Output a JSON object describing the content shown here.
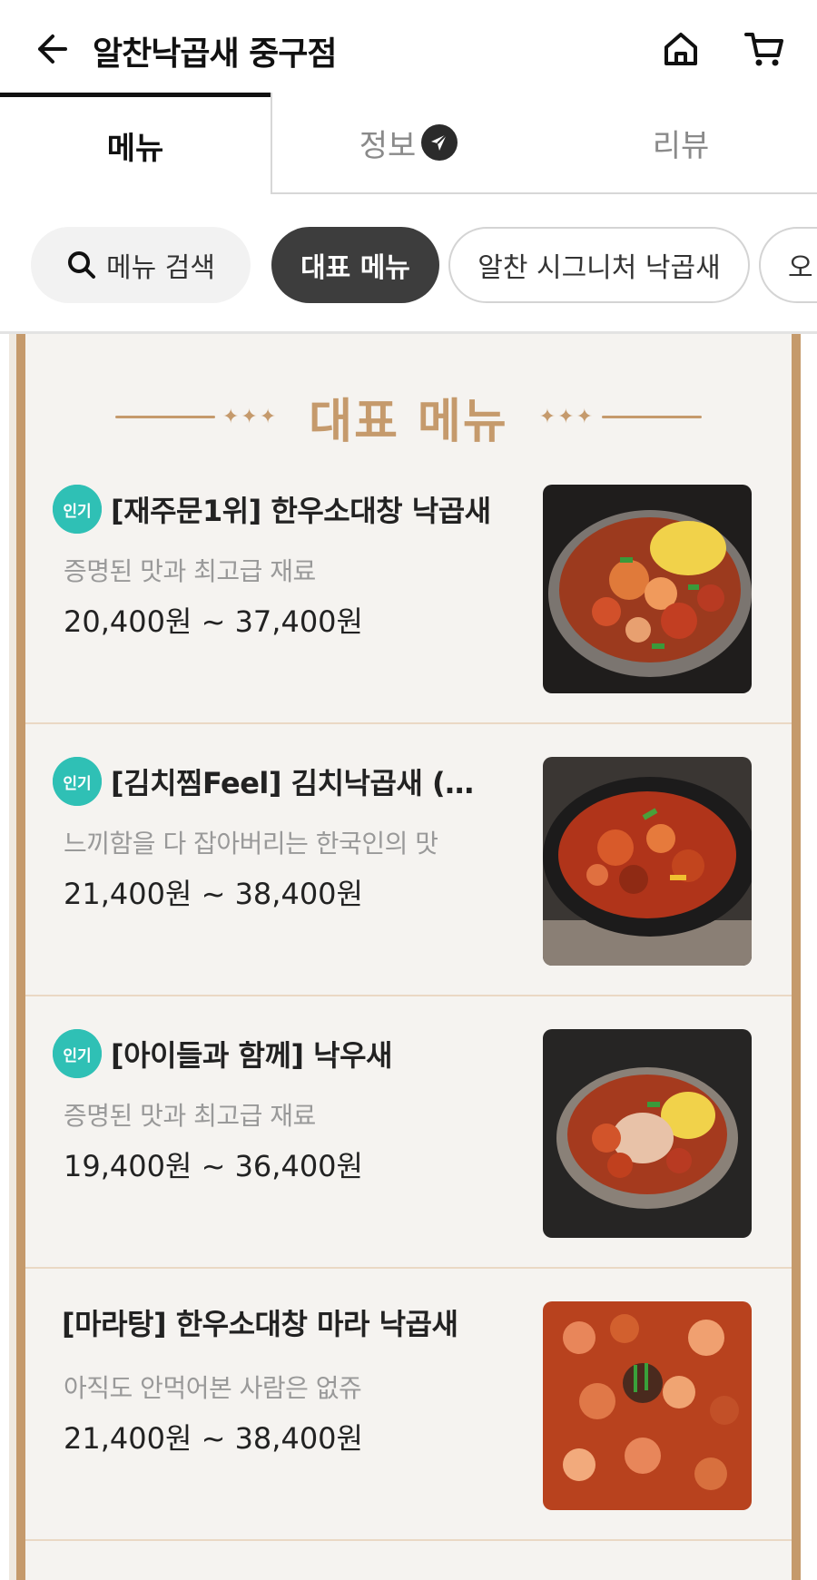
{
  "header": {
    "title": "알찬낙곱새 중구점",
    "back_icon": "arrow-left-icon",
    "home_icon": "home-icon",
    "cart_icon": "cart-icon"
  },
  "tabs": [
    {
      "label": "메뉴",
      "active": true
    },
    {
      "label": "정보",
      "icon": "announcement-badge-icon"
    },
    {
      "label": "리뷰"
    }
  ],
  "chips": {
    "search_label": "메뉴 검색",
    "items": [
      "대표 메뉴",
      "알찬 시그니처 낙곱새",
      "오"
    ]
  },
  "section": {
    "title": "대표 메뉴",
    "ornament_left": "✦✦✦",
    "ornament_right": "✦✦✦"
  },
  "menu_items": [
    {
      "badge": "인기",
      "name": "[재주문1위] 한우소대창 낙곱새",
      "desc": "증명된 맛과 최고급 재료",
      "price": "20,400원 ~ 37,400원"
    },
    {
      "badge": "인기",
      "name": "[김치찜Feel] 김치낙곱새 (…",
      "desc": "느끼함을 다 잡아버리는 한국인의 맛",
      "price": "21,400원 ~ 38,400원"
    },
    {
      "badge": "인기",
      "name": "[아이들과 함께] 낙우새",
      "desc": "증명된 맛과 최고급 재료",
      "price": "19,400원 ~ 36,400원"
    },
    {
      "badge": "",
      "name": "[마라탕] 한우소대창 마라 낙곱새",
      "desc": "아직도 안먹어본 사람은 없쥬",
      "price": "21,400원 ~ 38,400원"
    }
  ],
  "colors": {
    "accent_gold": "#c59a6c",
    "badge_teal": "#2fc0b5",
    "active_chip": "#3d3d3d"
  }
}
